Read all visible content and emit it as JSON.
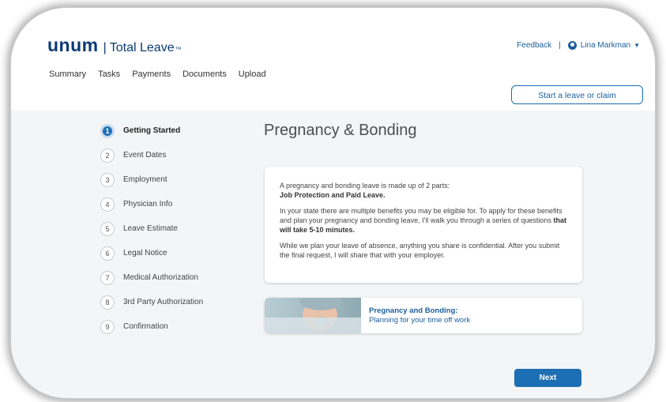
{
  "header": {
    "logo_text": "unum",
    "product_sep": "|",
    "product_name": "Total Leave",
    "product_tm": "™",
    "feedback_label": "Feedback",
    "divider": "|",
    "user_name": "Lina Markman",
    "user_caret": "▼"
  },
  "nav": {
    "items": [
      "Summary",
      "Tasks",
      "Payments",
      "Documents",
      "Upload"
    ]
  },
  "start_button_label": "Start a leave or claim",
  "steps": [
    {
      "num": "1",
      "label": "Getting Started"
    },
    {
      "num": "2",
      "label": "Event Dates"
    },
    {
      "num": "3",
      "label": "Employment"
    },
    {
      "num": "4",
      "label": "Physician Info"
    },
    {
      "num": "5",
      "label": "Leave Estimate"
    },
    {
      "num": "6",
      "label": "Legal Notice"
    },
    {
      "num": "7",
      "label": "Medical Authorization"
    },
    {
      "num": "8",
      "label": "3rd Party Authorization"
    },
    {
      "num": "9",
      "label": "Confirmation"
    }
  ],
  "active_step": 1,
  "page_title": "Pregnancy & Bonding",
  "card": {
    "p1_text": "A pregnancy and bonding leave is made up of 2 parts:",
    "p1_bold": "Job Protection and Paid Leave.",
    "p2_text": "In your state there are multiple benefits you may be eligible for. To apply for these benefits and plan your pregnancy and bonding leave, I'll walk you through a series of questions ",
    "p2_bold": "that will take 5-10 minutes.",
    "p3_text": "While we plan your leave of absence, anything you share is confidential. After you submit the final request, I will share that with your employer."
  },
  "promo": {
    "title": "Pregnancy and Bonding:",
    "subtitle": "Planning for your time off work"
  },
  "next_button_label": "Next",
  "colors": {
    "brand": "#0b3b73",
    "accent": "#1d6fb3",
    "link": "#1b5e9c"
  },
  "icons": {
    "user": "user-circle-icon",
    "caret": "caret-down-icon"
  }
}
